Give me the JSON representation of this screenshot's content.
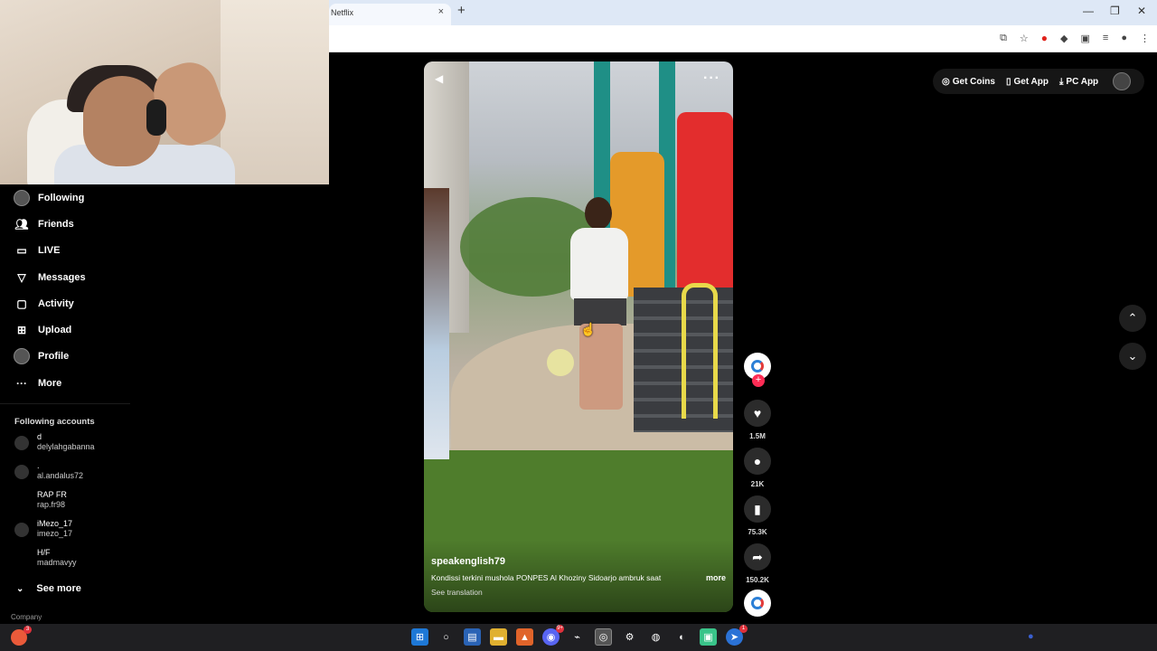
{
  "browser": {
    "tab_title": "Netflix",
    "tab_close": "×",
    "new_tab": "+",
    "window_controls": [
      "—",
      "❐",
      "✕"
    ]
  },
  "sidebar": {
    "nav": [
      {
        "label": "Following",
        "icon": "avatar-icon"
      },
      {
        "label": "Friends",
        "icon": "friends-icon"
      },
      {
        "label": "LIVE",
        "icon": "live-icon"
      },
      {
        "label": "Messages",
        "icon": "messages-icon"
      },
      {
        "label": "Activity",
        "icon": "activity-icon"
      },
      {
        "label": "Upload",
        "icon": "upload-icon"
      },
      {
        "label": "Profile",
        "icon": "profile-icon"
      },
      {
        "label": "More",
        "icon": "more-icon"
      }
    ],
    "following_title": "Following accounts",
    "accounts": [
      {
        "name": "d",
        "handle": "delylahgabanna"
      },
      {
        "name": ".",
        "handle": "al.andalus72"
      },
      {
        "name": "RAP FR",
        "handle": "rap.fr98"
      },
      {
        "name": "iMezo_17",
        "handle": "imezo_17"
      },
      {
        "name": "H/F",
        "handle": "madmavyy"
      }
    ],
    "see_more": "See more",
    "company": "Company"
  },
  "topbar": {
    "get_coins": "Get Coins",
    "get_app": "Get App",
    "pc_app": "PC App"
  },
  "video": {
    "author": "speakenglish79",
    "description": "Kondissi terkini mushola PONPES Al Khoziny Sidoarjo ambruk saat",
    "more_label": "more",
    "see_translation": "See translation",
    "menu_dots": "···"
  },
  "actions": {
    "likes": "1.5M",
    "comments": "21K",
    "saves": "75.3K",
    "shares": "150.2K"
  },
  "taskbar": {
    "discord_badge": "9+",
    "app_badge": "1",
    "left_badge": "3"
  }
}
